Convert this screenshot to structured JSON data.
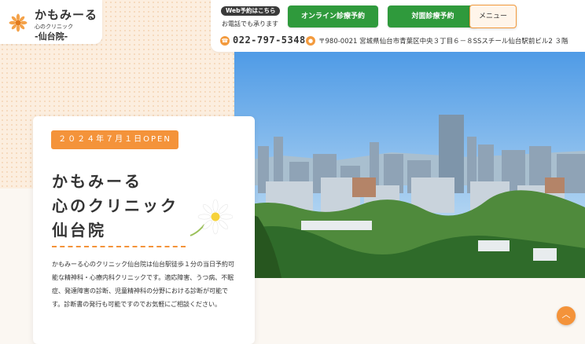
{
  "logo": {
    "name": "かもみーる",
    "sub1": "心のクリニック",
    "sub2": "-仙台院-",
    "icon": "chamomile-icon"
  },
  "header": {
    "web_badge": "Web予約はこちら",
    "phone_note": "お電話でも承ります",
    "online_button": "オンライン診療予約",
    "visit_button": "対面診療予約",
    "menu_button": "メニュー",
    "phone_icon": "phone-icon",
    "phone_number": "022-797-5348",
    "pin_icon": "location-pin-icon",
    "address": "〒980-0021 宮城県仙台市青葉区中央３丁目６－８SSスチール仙台駅前ビル2 ３階"
  },
  "hero": {
    "open_badge": "２０２４年７月１日OPEN",
    "title_line1": "かもみーる",
    "title_line2": "心のクリニック",
    "title_line3": "仙台院",
    "description": "かもみーる心のクリニック仙台院は仙台駅徒歩１分の当日予約可能な精神科・心療内科クリニックです。適応障害、うつ病、不眠症、発達障害の診断、児童精神科の分野における診断が可能です。診断書の発行も可能ですのでお気軽にご相談ください。"
  },
  "scroll_top": "︿",
  "colors": {
    "accent": "#f4933a",
    "green": "#2f9a3c",
    "text": "#333333"
  }
}
